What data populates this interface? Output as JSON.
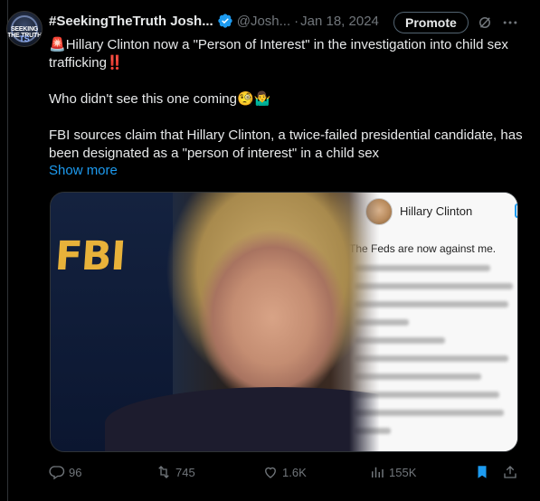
{
  "tweet": {
    "display_name": "#SeekingTheTruth Josh...",
    "handle": "@Josh...",
    "separator": "·",
    "date": "Jan 18, 2024",
    "promote_label": "Promote",
    "avatar_text": "SEEKING THE TRUTH",
    "avatar_ts": "TS",
    "text": {
      "line1_emoji": "🚨",
      "line1": "Hillary Clinton now a \"Person of Interest\" in the investigation into child sex trafficking",
      "line1_end_emoji": "‼️",
      "line2": "Who didn't see this one coming",
      "line2_emojis": "🧐🤷‍♂️",
      "line3": "FBI sources claim that Hillary Clinton, a twice-failed presidential candidate, has been designated as a \"person of interest\" in a child sex"
    },
    "show_more": "Show more",
    "media": {
      "fbi_label": "FBI",
      "card_name": "Hillary Clinton",
      "card_line1": "The Feds are now against me."
    },
    "stats": {
      "replies": "96",
      "reposts": "745",
      "likes": "1.6K",
      "views": "155K"
    },
    "colors": {
      "accent": "#1d9bf0",
      "verified": "#1d9bf0",
      "muted": "#71767b",
      "repost_green": "#00ba7c",
      "background": "#000000"
    },
    "icons": [
      "verified-badge-icon",
      "grok-icon",
      "more-icon",
      "reply-icon",
      "repost-icon",
      "like-icon",
      "views-icon",
      "bookmark-icon",
      "share-icon"
    ]
  }
}
